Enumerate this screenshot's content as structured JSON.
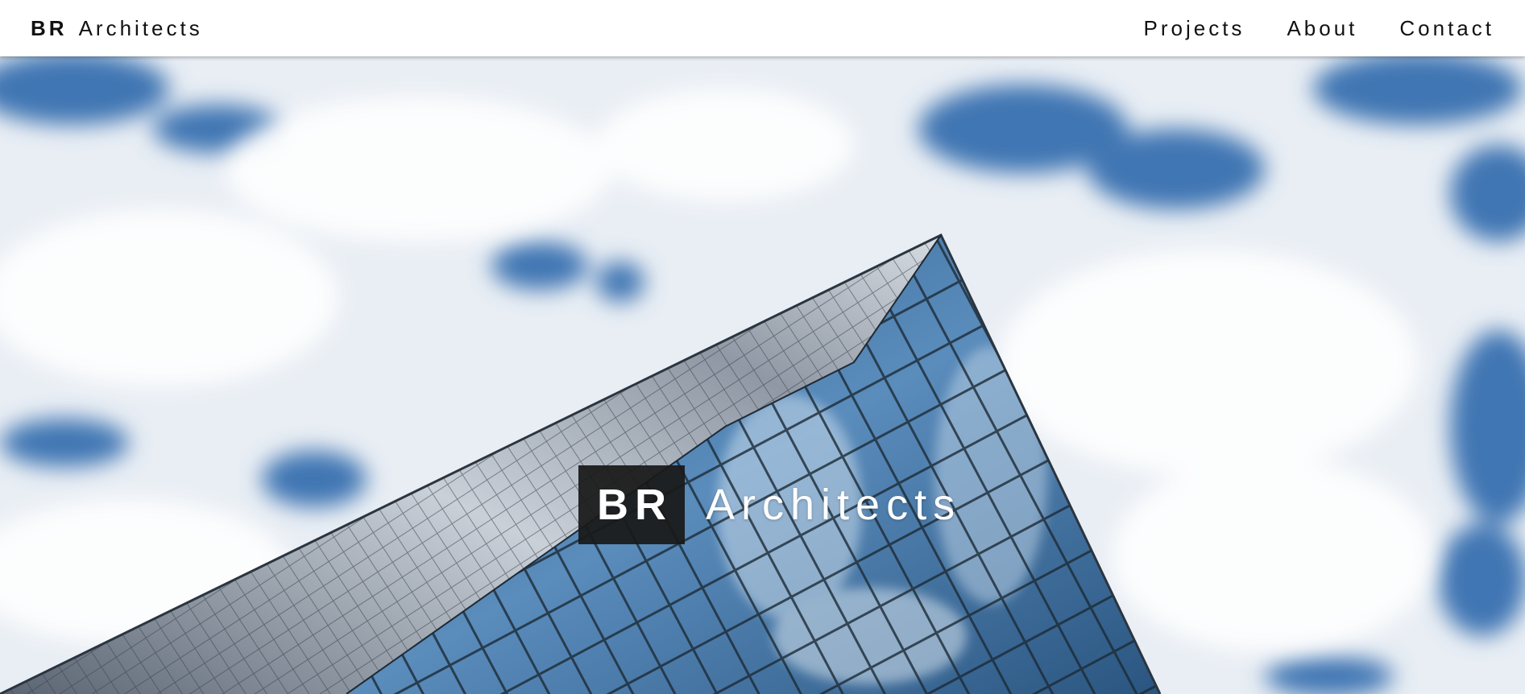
{
  "navbar": {
    "brand_bold": "BR",
    "brand_rest": "Architects",
    "links": [
      {
        "label": "Projects"
      },
      {
        "label": "About"
      },
      {
        "label": "Contact"
      }
    ]
  },
  "hero": {
    "image": "glass-skyscraper-against-cloudy-sky",
    "title_box": "BR",
    "title_text": "Architects"
  },
  "colors": {
    "navbar_bg": "#ffffff",
    "text_dark": "#111111",
    "sky_blue": "#4b7fb8",
    "cloud_white": "#f4f6f9",
    "title_box_bg": "#191919",
    "title_text": "#ffffff"
  }
}
